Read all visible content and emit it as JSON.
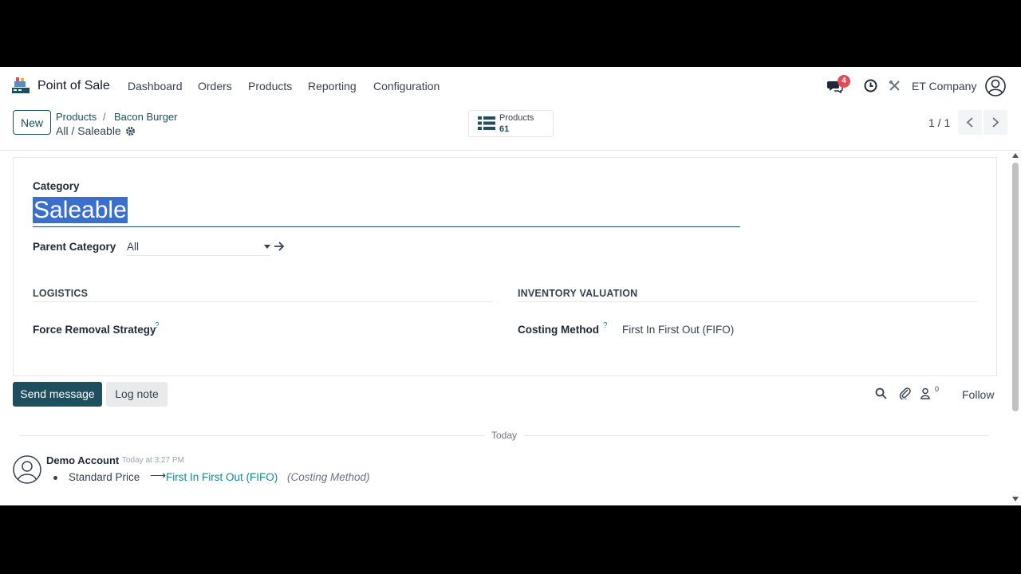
{
  "app": {
    "title": "Point of Sale",
    "logo_icon": "pos-logo-icon"
  },
  "nav": {
    "menus": [
      "Dashboard",
      "Orders",
      "Products",
      "Reporting",
      "Configuration"
    ],
    "messages_badge": "4",
    "company": "ET Company"
  },
  "control_panel": {
    "new_label": "New",
    "breadcrumb": [
      "Products",
      "Bacon Burger"
    ],
    "record_path": "All / Saleable",
    "smart_button": {
      "label": "Products",
      "count": "61"
    },
    "pager": "1 / 1"
  },
  "form": {
    "category_label": "Category",
    "category_value": "Saleable",
    "parent_label": "Parent Category",
    "parent_value": "All",
    "logistics_title": "LOGISTICS",
    "removal_label": "Force Removal Strategy",
    "valuation_title": "INVENTORY VALUATION",
    "costing_label": "Costing Method",
    "costing_value": "First In First Out (FIFO)",
    "help_mark": "?"
  },
  "chatter": {
    "send_label": "Send message",
    "log_label": "Log note",
    "followers_count": "0",
    "follow_label": "Follow",
    "date_separator": "Today",
    "message": {
      "author": "Demo Account",
      "time": "Today at 3:27 PM",
      "field": "Standard Price",
      "arrow": "⟶",
      "new_value": "First In First Out (FIFO)",
      "field_desc": "(Costing Method)"
    }
  },
  "colors": {
    "primary": "#1f4e5f",
    "link": "#0f8b8d",
    "selection": "#3a6fcc",
    "badge": "#e04a59"
  }
}
